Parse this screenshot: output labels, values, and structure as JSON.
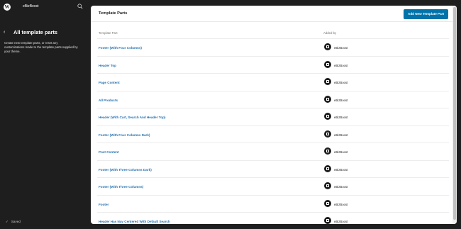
{
  "topbar": {
    "site_name": "eBizBoost"
  },
  "sidebar": {
    "title": "All template parts",
    "description": "Create new template parts, or reset any customizations made to the template parts supplied by your theme.",
    "saved_label": "Saved"
  },
  "main": {
    "title": "Template Parts",
    "add_button_label": "Add New Template Part",
    "columns": {
      "part": "Template Part",
      "added_by": "Added by"
    },
    "rows": [
      {
        "name": "Footer (With Four Columns)",
        "author": "eBizBoost"
      },
      {
        "name": "Header Top",
        "author": "eBizBoost"
      },
      {
        "name": "Page Content",
        "author": "eBizBoost"
      },
      {
        "name": "All Products",
        "author": "eBizBoost"
      },
      {
        "name": "Header (With Cart, Search And Header Top)",
        "author": "eBizBoost"
      },
      {
        "name": "Footer (With Four Columns Dark)",
        "author": "eBizBoost"
      },
      {
        "name": "Post Content",
        "author": "eBizBoost"
      },
      {
        "name": "Footer (With Three Columns Dark)",
        "author": "eBizBoost"
      },
      {
        "name": "Footer (With Three Columns)",
        "author": "eBizBoost"
      },
      {
        "name": "Footer",
        "author": "eBizBoost"
      },
      {
        "name": "Header Has Nav Centered With Default Search",
        "author": "eBizBoost"
      }
    ]
  },
  "colors": {
    "accent": "#0073aa",
    "link": "#2271b1",
    "sidebar_bg": "#1e1e1e"
  }
}
